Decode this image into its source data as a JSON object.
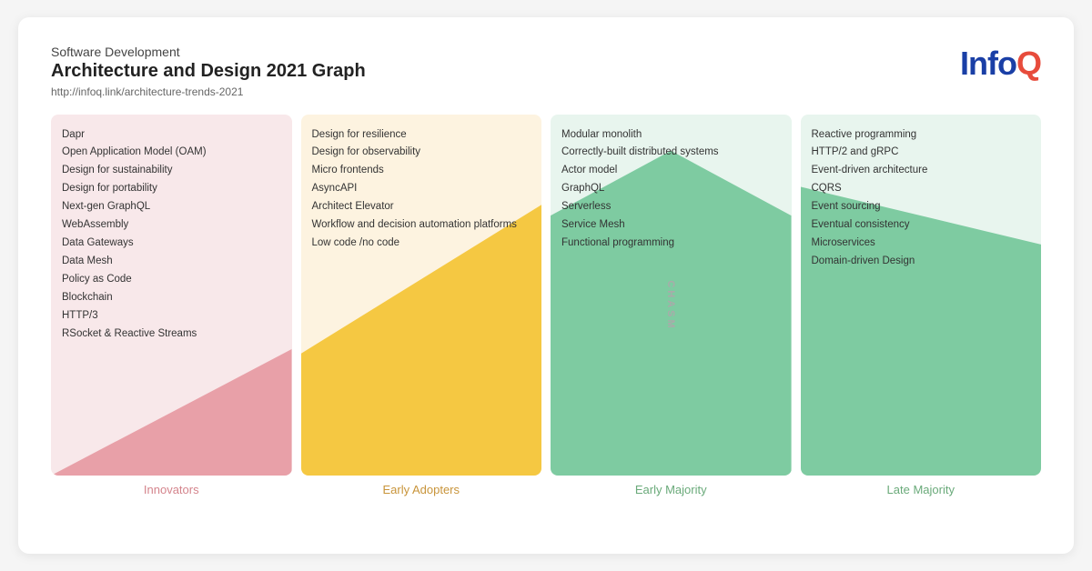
{
  "header": {
    "subtitle": "Software Development",
    "title": "Architecture and Design 2021 Graph",
    "url": "http://infoq.link/architecture-trends-2021",
    "logo": "InfoQ"
  },
  "columns": [
    {
      "id": "innovators",
      "label": "Innovators",
      "items": [
        "Dapr",
        "Open Application Model (OAM)",
        "Design for sustainability",
        "Design for portability",
        "Next-gen GraphQL",
        "WebAssembly",
        "Data Gateways",
        "Data Mesh",
        "Policy as Code",
        "Blockchain",
        "HTTP/3",
        "RSocket & Reactive Streams"
      ]
    },
    {
      "id": "early-adopters",
      "label": "Early Adopters",
      "items": [
        "Design for resilience",
        "Design for observability",
        "Micro frontends",
        "AsyncAPI",
        "Architect Elevator",
        "Workflow and decision automation platforms",
        "Low code /no code"
      ]
    },
    {
      "id": "early-majority",
      "label": "Early Majority",
      "chasm": "CHASM",
      "items": [
        "Modular monolith",
        "Correctly-built distributed systems",
        "Actor model",
        "GraphQL",
        "Serverless",
        "Service Mesh",
        "Functional programming"
      ]
    },
    {
      "id": "late-majority",
      "label": "Late Majority",
      "items": [
        "Reactive programming",
        "HTTP/2 and gRPC",
        "Event-driven architecture",
        "CQRS",
        "Event sourcing",
        "Eventual consistency",
        "Microservices",
        "Domain-driven Design"
      ]
    }
  ]
}
